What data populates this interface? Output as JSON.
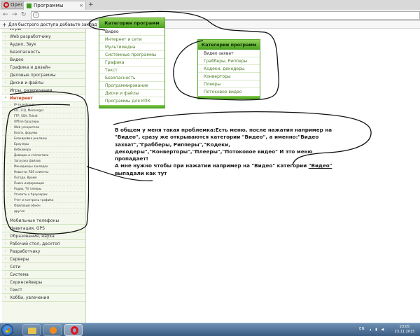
{
  "browser": {
    "menu_label": "Opera",
    "tab_title": "Программы",
    "tab_close": "×",
    "new_tab": "+",
    "bookmarks_plus": "+",
    "bookmarks_hint": "Для быстрого доступа добавьте заклад"
  },
  "sidebar": {
    "top_items_1": [
      "Игры",
      "Web разработчику",
      "Аудио, Звук",
      "Безопасность",
      "Видео",
      "Графика и дизайн",
      "Деловые программы",
      "Диски и файлы",
      "Игры, развлечения"
    ],
    "active_item": "Интернет",
    "sub_items": [
      "IP-телефония",
      "IRC, ICQ, Messenger",
      "FTP, SSH, Telnet",
      "Offline браузеры",
      "Web ускорители",
      "Блоги, форумы",
      "Блокировка рекламы",
      "Браузеры",
      "Вебкамера",
      "Доводки и статистика",
      "Загрузка файлов",
      "Менеджеры закладок",
      "Новости, RSS клиенты",
      "Погода, Время",
      "Поиск информации",
      "Радио, TV плееры",
      "Утилиты к браузерам",
      "Учет и контроль трафика",
      "Файловый обмен",
      "другое"
    ],
    "top_items_2": [
      "Мобильные телефоны",
      "Навигация, GPS",
      "Образование, наука",
      "Рабочий стол, десктоп",
      "Разработчику",
      "Серверы",
      "Сети",
      "Система",
      "Скринсейверы",
      "Текст",
      "Хобби, увлечения"
    ]
  },
  "menu_main": {
    "title": "Категории программ",
    "items": [
      "Видео",
      "Интернет и сети",
      "Мультимедиа",
      "Системные программы",
      "Графика",
      "Текст",
      "Безопасность",
      "Программирование",
      "Диски и файлы",
      "Программы для КПК"
    ]
  },
  "menu_sub": {
    "title": "Категории программ",
    "items": [
      "Видео захват",
      "Грабберы, Рипперы",
      "Кодеки, декодеры",
      "Конверторы",
      "Плееры",
      "Потоковое видео"
    ]
  },
  "comment": {
    "line1": "В общем у меня такая проблемка:Есть меню, после нажатия например на",
    "line2": "\"Видео\", сразу же открываются категории \"Видео\", а именно:\"Видео",
    "line3": "захват\",\"Грабберы, Рипперы\",\"Кодеки,",
    "line4": "декодеры\",\"Конверторы\",\"Плееры\",\"Потоковое видео\" И это меню пропадает!",
    "line5_a": "А мне нужно чтобы при нажатии например на \"Видео\" категории ",
    "line5_b": "\"Видео\"",
    "line6": "выпадали как тут"
  },
  "taskbar": {
    "lang": "EN",
    "time": "23:05",
    "date": "23.11.2015"
  },
  "colors": {
    "menu_green": "#4aa21f",
    "link_green": "#4a7a24",
    "active_orange": "#c0390f"
  }
}
